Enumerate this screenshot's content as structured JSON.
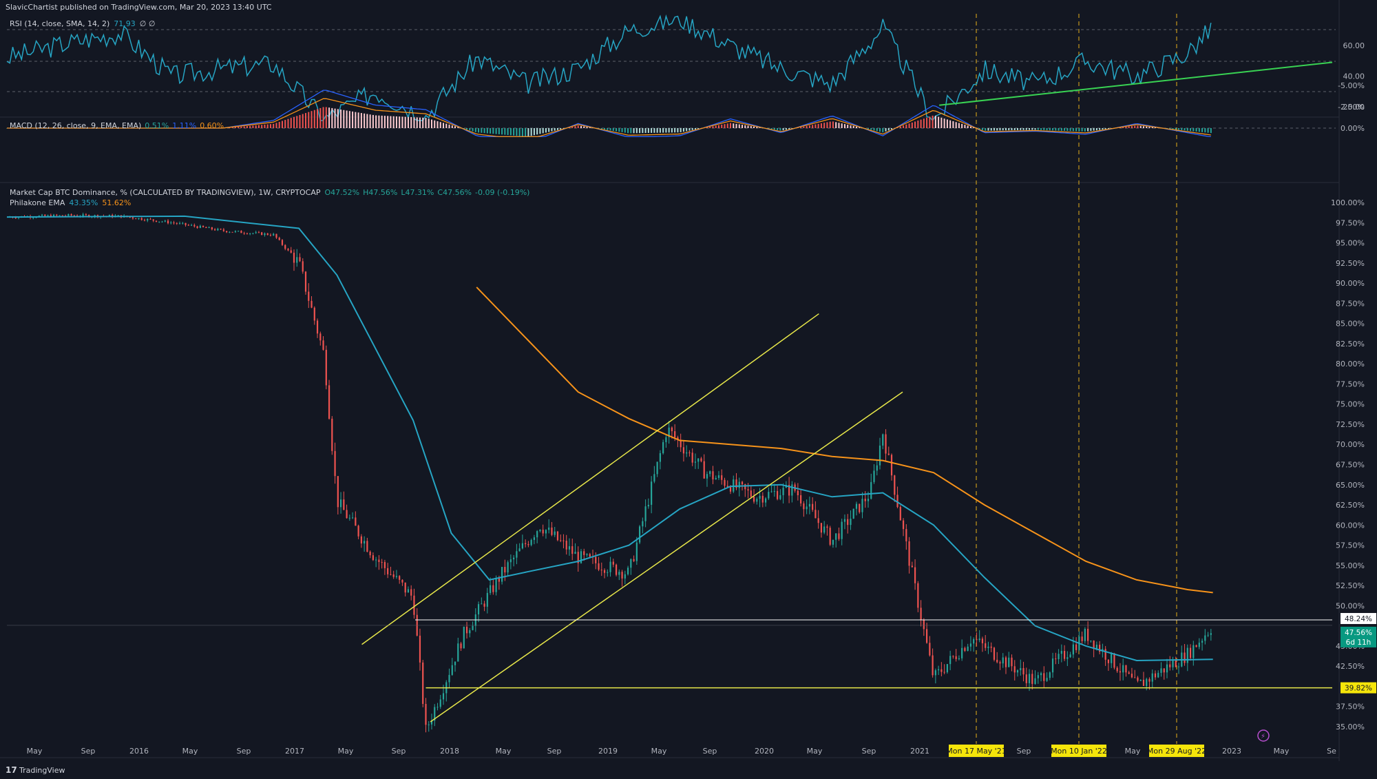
{
  "header": {
    "publisher": "SlavicChartist published on TradingView.com, Mar 20, 2023 13:40 UTC"
  },
  "rsi": {
    "label": "RSI (14, close, SMA, 14, 2)",
    "value": "71.93",
    "extra": "∅ ∅",
    "axis_ticks": [
      "60.00",
      "40.00",
      "20.00"
    ],
    "color": "#26a5c4"
  },
  "macd": {
    "label": "MACD (12, 26, close, 9, EMA, EMA)",
    "v1": "0.51%",
    "v2": "1.11%",
    "v3": "0.60%",
    "axis_ticks": [
      "0.00%",
      "-2.50%",
      "-5.00%"
    ]
  },
  "main": {
    "label": "Market Cap BTC Dominance, % (CALCULATED BY TRADINGVIEW), 1W, CRYPTOCAP",
    "o": "O47.52%",
    "h": "H47.56%",
    "l": "L47.31%",
    "c": "C47.56%",
    "chg": "-0.09 (-0.19%)",
    "indicator_label": "Philakone EMA",
    "ema1": "43.35%",
    "ema2": "51.62%",
    "axis_ticks": [
      "100.00%",
      "97.50%",
      "95.00%",
      "92.50%",
      "90.00%",
      "87.50%",
      "85.00%",
      "82.50%",
      "80.00%",
      "77.50%",
      "75.00%",
      "72.50%",
      "70.00%",
      "67.50%",
      "65.00%",
      "62.50%",
      "60.00%",
      "57.50%",
      "55.00%",
      "52.50%",
      "50.00%",
      "45.00%",
      "42.50%",
      "37.50%",
      "35.00%"
    ],
    "price_tags": {
      "top": "48.24%",
      "current": "47.56%",
      "countdown": "6d 11h",
      "support": "39.82%"
    }
  },
  "time_axis": {
    "labels": [
      "May",
      "Sep",
      "2016",
      "May",
      "Sep",
      "2017",
      "May",
      "Sep",
      "2018",
      "May",
      "Sep",
      "2019",
      "May",
      "Sep",
      "2020",
      "May",
      "Sep",
      "2021",
      "Sep",
      "May",
      "2023",
      "May",
      "Se"
    ],
    "highlight_labels": [
      "Mon 17 May '21",
      "Mon 10 Jan '22",
      "Mon 29 Aug '22"
    ]
  },
  "footer": {
    "brand": "TradingView"
  },
  "colors": {
    "bg": "#131722",
    "up": "#26a69a",
    "down": "#ef5350",
    "ema_blue": "#26a5c4",
    "ema_orange": "#f7931a",
    "trend_yellow": "#e8e84a",
    "rsi_trend": "#39d353",
    "highlight": "#f5e50a"
  },
  "chart_data": [
    {
      "type": "line",
      "name": "RSI",
      "x": [
        "2015-04",
        "2015-09",
        "2016-01",
        "2016-05",
        "2016-09",
        "2017-01",
        "2017-05",
        "2017-09",
        "2018-01",
        "2018-05",
        "2018-09",
        "2019-01",
        "2019-05",
        "2019-09",
        "2020-01",
        "2020-05",
        "2020-09",
        "2021-01",
        "2021-05",
        "2021-09",
        "2022-01",
        "2022-05",
        "2022-09",
        "2023-01",
        "2023-03"
      ],
      "y": [
        52,
        62,
        68,
        40,
        45,
        48,
        12,
        30,
        14,
        52,
        35,
        45,
        70,
        78,
        60,
        45,
        35,
        72,
        12,
        44,
        35,
        50,
        40,
        55,
        71.93
      ],
      "ylim": [
        10,
        80
      ]
    },
    {
      "type": "bar",
      "name": "MACD histogram",
      "x": [
        "2015-04",
        "2015-09",
        "2016-01",
        "2016-05",
        "2016-09",
        "2017-01",
        "2017-05",
        "2017-09",
        "2018-01",
        "2018-05",
        "2018-09",
        "2019-01",
        "2019-05",
        "2019-09",
        "2020-01",
        "2020-05",
        "2020-09",
        "2021-01",
        "2021-05",
        "2021-09",
        "2022-01",
        "2022-05",
        "2022-09",
        "2023-01",
        "2023-03"
      ],
      "values": [
        0,
        0,
        0,
        0,
        0,
        -0.5,
        -2.5,
        -1.5,
        -1.2,
        0.5,
        1.0,
        -0.3,
        0.6,
        0.5,
        -0.6,
        0.3,
        -0.8,
        0.5,
        -1.5,
        0.3,
        0.2,
        0.4,
        -0.3,
        0.3,
        0.6
      ],
      "ylim": [
        -6,
        1
      ]
    },
    {
      "type": "line",
      "name": "BTC Dominance",
      "x": [
        "2015-04",
        "2015-09",
        "2016-01",
        "2016-05",
        "2016-09",
        "2017-01",
        "2017-03",
        "2017-05",
        "2017-06",
        "2017-09",
        "2017-12",
        "2018-01",
        "2018-04",
        "2018-07",
        "2018-10",
        "2019-01",
        "2019-05",
        "2019-08",
        "2019-11",
        "2020-03",
        "2020-06",
        "2020-09",
        "2020-12",
        "2021-01",
        "2021-05",
        "2021-08",
        "2022-01",
        "2022-05",
        "2022-09",
        "2023-01",
        "2023-03"
      ],
      "y": [
        98.2,
        98.4,
        98.3,
        97.5,
        96.5,
        96.0,
        92.5,
        81.0,
        63.0,
        56.0,
        51.0,
        34.5,
        46.5,
        54.0,
        60.0,
        56.0,
        54.0,
        72.0,
        66.5,
        63.5,
        64.5,
        58.0,
        64.0,
        71.5,
        41.0,
        46.0,
        40.5,
        46.5,
        40.0,
        44.0,
        47.56
      ],
      "ylim": [
        34,
        101
      ]
    },
    {
      "type": "line",
      "name": "Philakone EMA 43.35%",
      "x": [
        "2015-04",
        "2016-06",
        "2017-03",
        "2017-06",
        "2017-09",
        "2017-12",
        "2018-03",
        "2018-06",
        "2018-09",
        "2019-01",
        "2019-05",
        "2019-09",
        "2020-01",
        "2020-05",
        "2020-09",
        "2021-01",
        "2021-05",
        "2021-09",
        "2022-01",
        "2022-05",
        "2022-09",
        "2023-03"
      ],
      "y": [
        98.2,
        98.3,
        96.8,
        91.0,
        82.0,
        73.0,
        59.0,
        53.2,
        54.2,
        55.5,
        57.5,
        62.0,
        64.8,
        65.0,
        63.5,
        64.0,
        60.0,
        53.5,
        47.5,
        45.0,
        43.2,
        43.35
      ],
      "ylim": [
        34,
        101
      ]
    },
    {
      "type": "line",
      "name": "Philakone EMA 51.62%",
      "x": [
        "2018-05",
        "2018-09",
        "2019-01",
        "2019-05",
        "2019-09",
        "2020-01",
        "2020-05",
        "2020-09",
        "2021-01",
        "2021-05",
        "2021-09",
        "2022-01",
        "2022-05",
        "2022-09",
        "2023-01",
        "2023-03"
      ],
      "y": [
        89.5,
        83.0,
        76.5,
        73.2,
        70.5,
        70.0,
        69.5,
        68.5,
        68.0,
        66.5,
        62.5,
        59.0,
        55.5,
        53.2,
        52.0,
        51.62
      ],
      "ylim": [
        34,
        101
      ]
    }
  ]
}
